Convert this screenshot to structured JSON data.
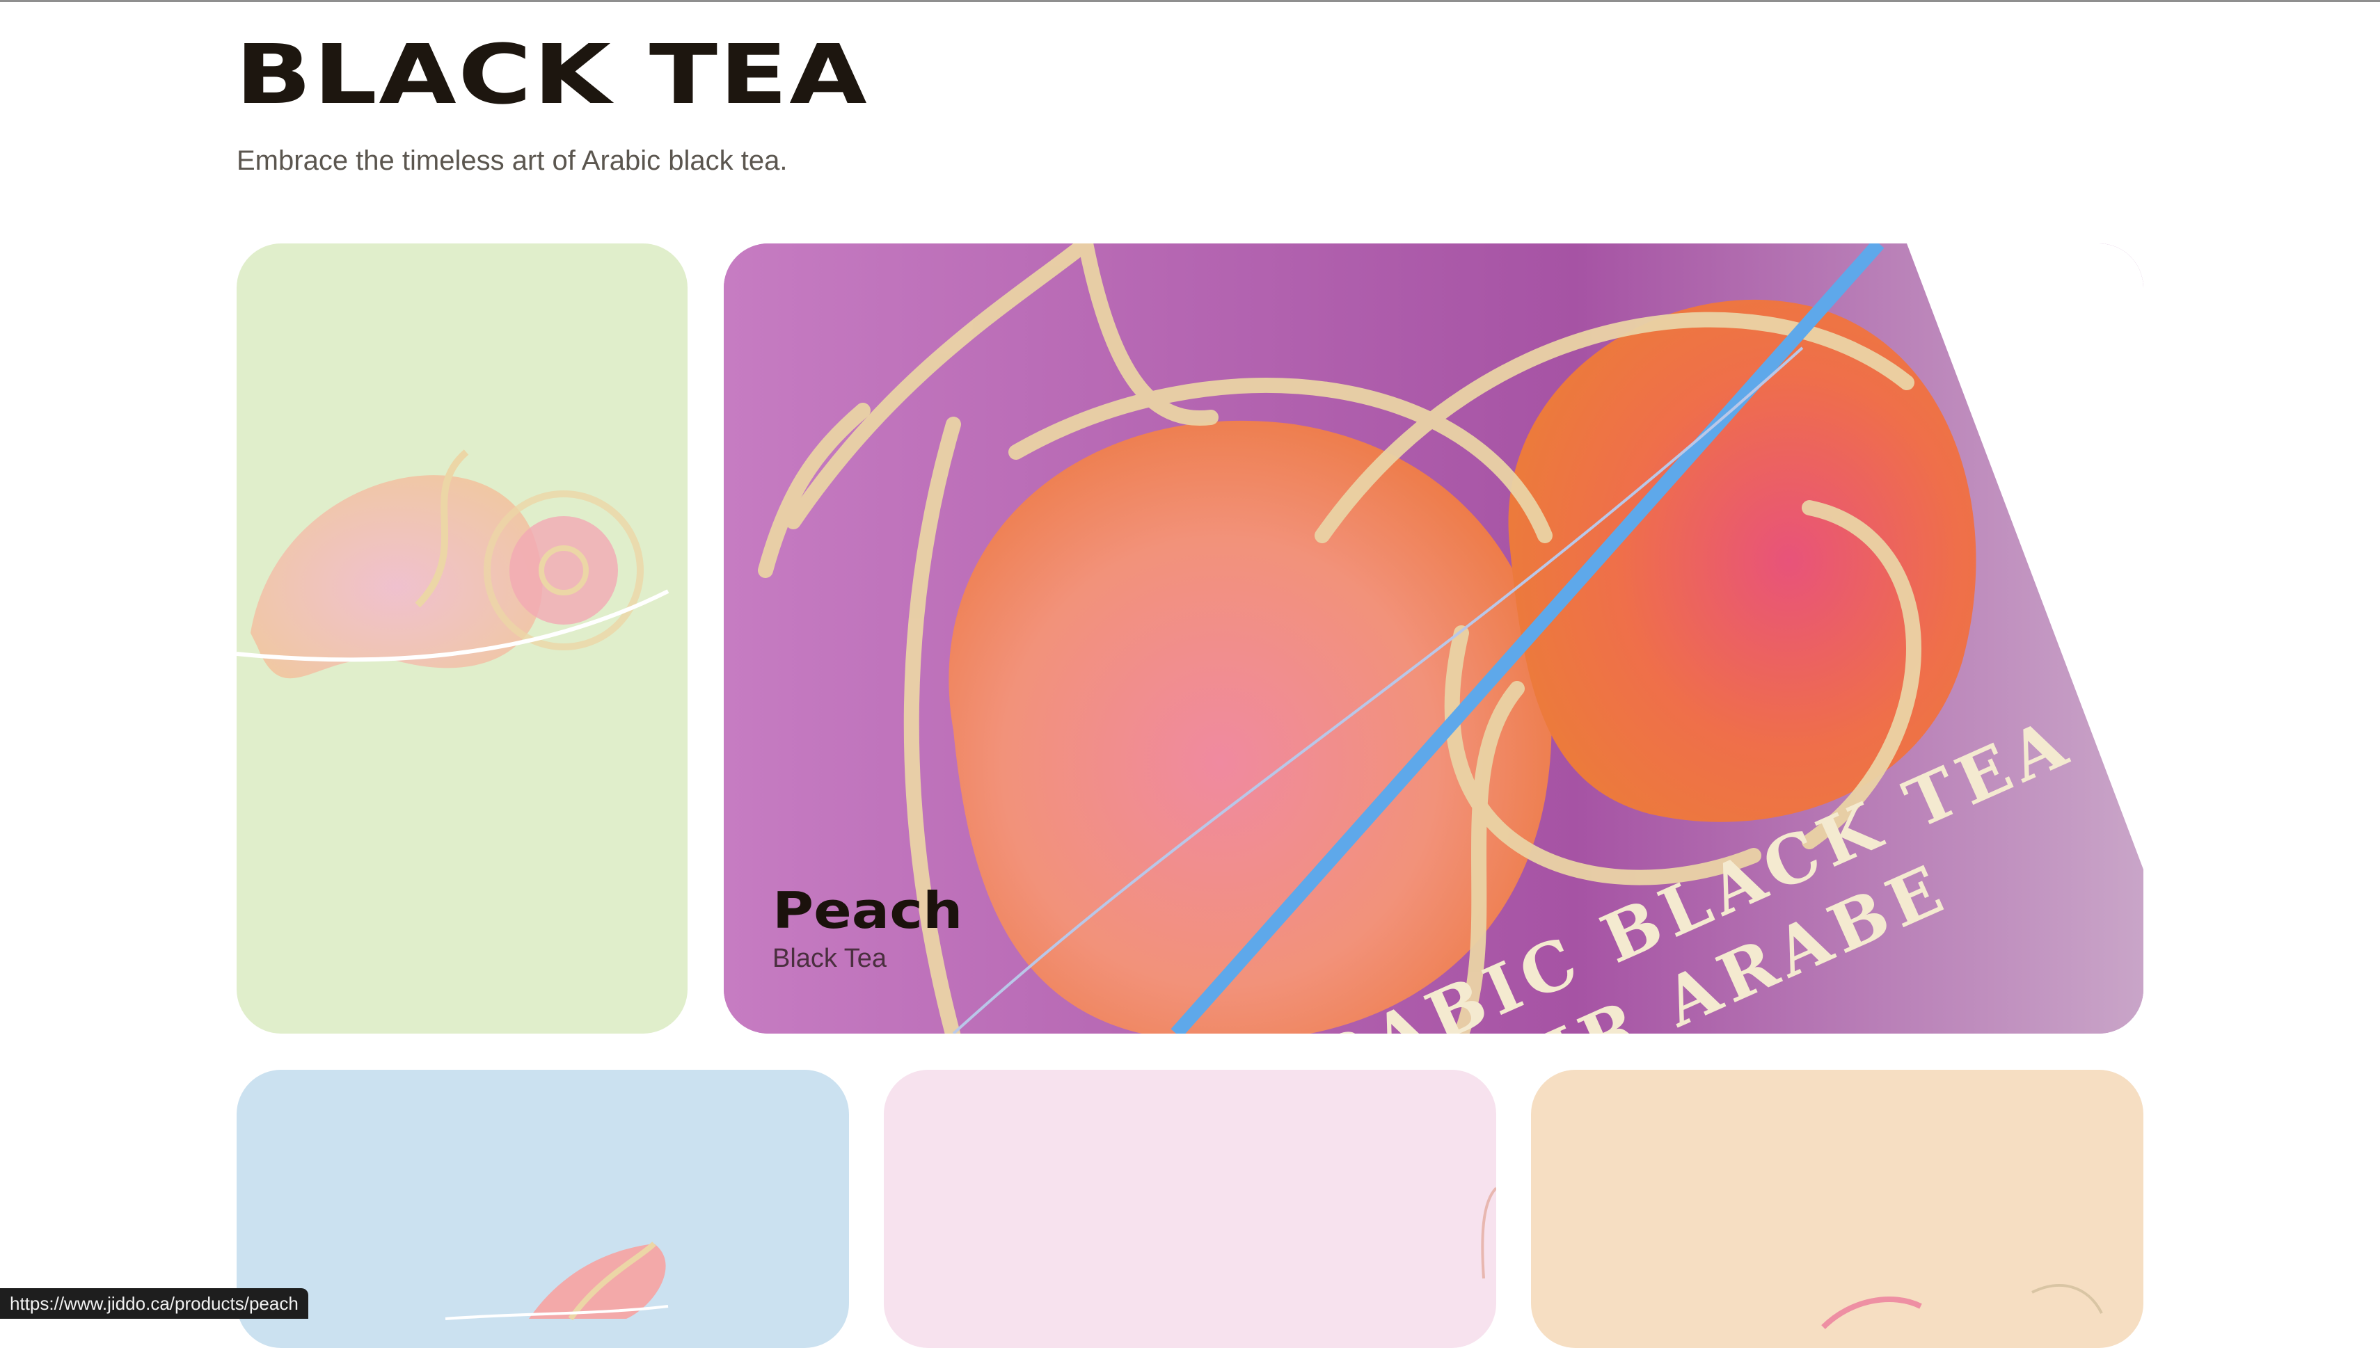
{
  "header": {
    "title": "BLACK TEA",
    "subtitle": "Embrace the timeless art of Arabic black tea."
  },
  "products": [
    {
      "id": "green",
      "color": "#e0eecb"
    },
    {
      "id": "peach",
      "title": "Peach",
      "subtitle": "Black Tea",
      "color": "#b46fb6",
      "label_text": "ARABIC BLACK TEA · NOIR ARABE"
    },
    {
      "id": "blue",
      "color": "#cbe1f0"
    },
    {
      "id": "pink",
      "color": "#f7e2ee"
    },
    {
      "id": "orange",
      "color": "#f6dec2"
    }
  ],
  "status_bar": {
    "url": "https://www.jiddo.ca/products/peach"
  },
  "icons": [
    "peach-illustration",
    "citrus-illustration",
    "gold-ribbon-illustration"
  ]
}
